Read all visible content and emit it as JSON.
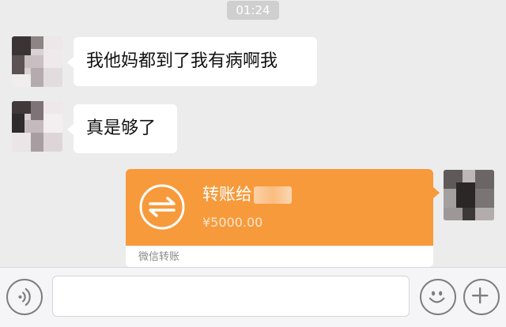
{
  "chat": {
    "timestamp": "01:24",
    "messages": [
      {
        "sender": "contact",
        "text": "我他妈都到了我有病啊我"
      },
      {
        "sender": "contact",
        "text": "真是够了"
      }
    ],
    "transfer": {
      "title": "转账给",
      "amount": "¥5000.00",
      "footer": "微信转账",
      "accent_color": "#f79a3b"
    }
  },
  "input_bar": {
    "icons": [
      "voice-icon",
      "emoji-icon",
      "plus-icon"
    ],
    "text_value": ""
  },
  "colors": {
    "background": "#ececec",
    "bubble_in": "#ffffff",
    "timestamp_bg": "#cfcfcf"
  }
}
